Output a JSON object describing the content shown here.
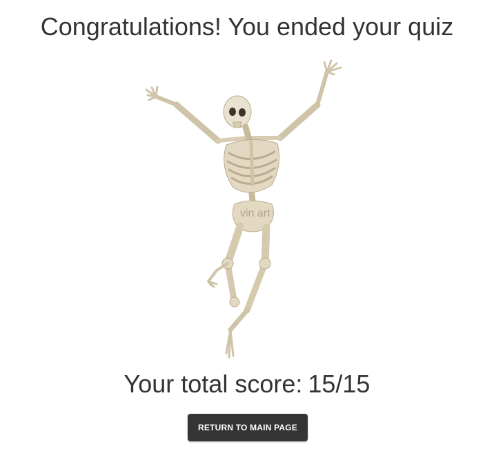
{
  "header": {
    "title": "Congratulations! You ended your quiz"
  },
  "illustration": {
    "icon": "dancing-skeleton-illustration",
    "watermark": "vin art"
  },
  "result": {
    "label": "Your total score:",
    "score": "15/15"
  },
  "actions": {
    "return_label": "RETURN TO MAIN PAGE"
  },
  "colors": {
    "text": "#333333",
    "button_bg": "#343434",
    "button_text": "#ffffff",
    "bone": "#e6ddc9",
    "bone_shadow": "#b9ab8e"
  }
}
